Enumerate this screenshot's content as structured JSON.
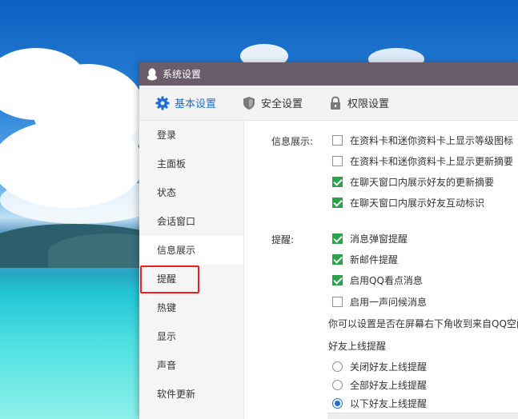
{
  "window": {
    "title": "系统设置",
    "titlebar_color": "#6a5c6a"
  },
  "tabs": [
    {
      "label": "基本设置",
      "icon": "gear-icon",
      "active": true
    },
    {
      "label": "安全设置",
      "icon": "shield-icon",
      "active": false
    },
    {
      "label": "权限设置",
      "icon": "lock-icon",
      "active": false
    }
  ],
  "sidebar": {
    "items": [
      {
        "label": "登录"
      },
      {
        "label": "主面板"
      },
      {
        "label": "状态"
      },
      {
        "label": "会话窗口"
      },
      {
        "label": "信息展示",
        "active": true
      },
      {
        "label": "提醒",
        "highlighted": true
      },
      {
        "label": "热键"
      },
      {
        "label": "显示"
      },
      {
        "label": "声音"
      },
      {
        "label": "软件更新"
      }
    ]
  },
  "info_display": {
    "label": "信息展示:",
    "options": [
      {
        "label": "在资料卡和迷你资料卡上显示等级图标",
        "checked": false
      },
      {
        "label": "在资料卡和迷你资料卡上显示更新摘要",
        "checked": false
      },
      {
        "label": "在聊天窗口内展示好友的更新摘要",
        "checked": true
      },
      {
        "label": "在聊天窗口内展示好友互动标识",
        "checked": true
      }
    ]
  },
  "reminder": {
    "label": "提醒:",
    "options": [
      {
        "label": "消息弹窗提醒",
        "checked": true
      },
      {
        "label": "新邮件提醒",
        "checked": true
      },
      {
        "label": "启用QQ看点消息",
        "checked": true
      },
      {
        "label": "启用一声问候消息",
        "checked": false
      }
    ],
    "hint": "你可以设置是否在屏幕右下角收到来自QQ空间",
    "friend_online_title": "好友上线提醒",
    "friend_online_options": [
      {
        "label": "关闭好友上线提醒",
        "selected": false
      },
      {
        "label": "全部好友上线提醒",
        "selected": false
      },
      {
        "label": "以下好友上线提醒",
        "selected": true
      }
    ]
  },
  "colors": {
    "accent": "#1a6fd6",
    "check_green": "#2aa34a",
    "highlight_red": "#e8231d"
  }
}
